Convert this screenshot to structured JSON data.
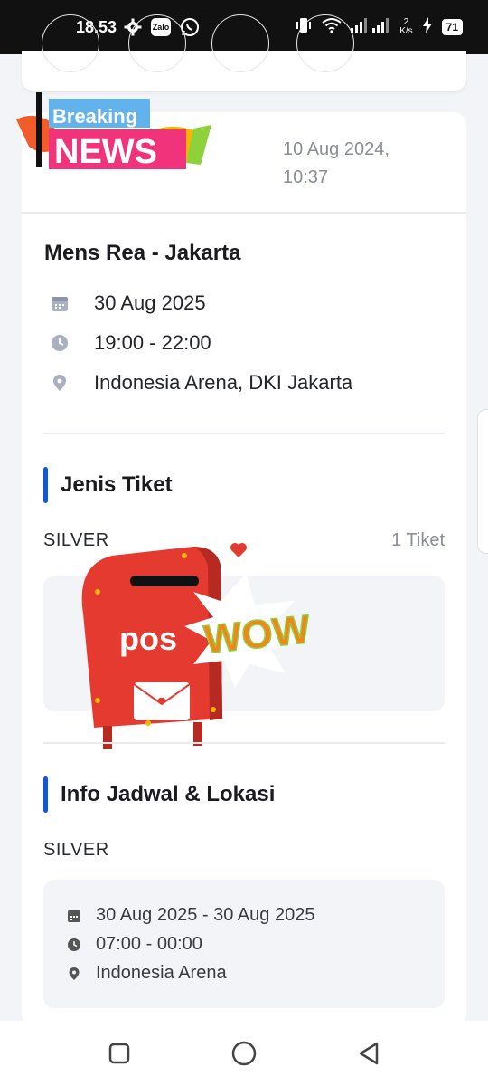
{
  "status_bar": {
    "time": "18.53",
    "zalo_label": "Zalo",
    "net_speed_value": "2",
    "net_speed_unit": "K/s",
    "battery": "71"
  },
  "news_logo": {
    "line1": "Breaking",
    "line2": "NEWS",
    "date": "10 Aug 2024,\n10:37"
  },
  "event": {
    "title": "Mens Rea - Jakarta",
    "date": "30 Aug 2025",
    "time": "19:00 - 22:00",
    "location": "Indonesia Arena, DKI Jakarta"
  },
  "ticket_section": {
    "title": "Jenis Tiket",
    "tier": "SILVER",
    "count": "1 Tiket"
  },
  "sticker": {
    "pos_text": "pos",
    "wow_text": "WOW"
  },
  "schedule_section": {
    "title": "Info Jadwal & Lokasi",
    "tier": "SILVER",
    "date_range": "30 Aug 2025 - 30 Aug 2025",
    "time_range": "07:00 - 00:00",
    "venue": "Indonesia Arena"
  },
  "colors": {
    "accent": "#1257d8",
    "postbox_red": "#e53a2f",
    "news_pink": "#f0337a",
    "breaking_blue": "#3ea4e8"
  },
  "icons": [
    "gear-icon",
    "zalo-icon",
    "whatsapp-icon",
    "vibrate-icon",
    "wifi-icon",
    "signal-icon",
    "charging-icon",
    "battery-icon",
    "calendar-icon",
    "clock-icon",
    "location-pin-icon",
    "recents-icon",
    "home-icon",
    "back-icon"
  ]
}
